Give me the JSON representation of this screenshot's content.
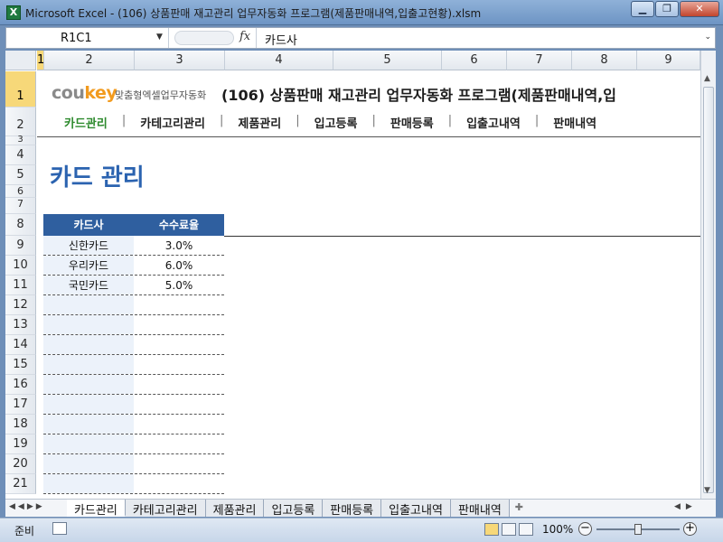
{
  "window": {
    "title": "Microsoft Excel - (106) 상품판매 재고관리 업무자동화 프로그램(제품판매내역,입출고현황).xlsm",
    "icon": "excel-icon",
    "minimize": "▁",
    "restore": "❐",
    "close": "✕"
  },
  "formula_bar": {
    "name_box": "R1C1",
    "fx": "fx",
    "content": "카드사"
  },
  "grid": {
    "columns": [
      "1",
      "2",
      "3",
      "4",
      "5",
      "6",
      "7",
      "8",
      "9"
    ],
    "rows": [
      "1",
      "2",
      "3",
      "4",
      "5",
      "6",
      "7",
      "8",
      "9",
      "10",
      "11",
      "12",
      "13",
      "14",
      "15",
      "16",
      "17",
      "18",
      "19",
      "20",
      "21"
    ]
  },
  "sheet": {
    "logo_text": "cou",
    "logo_accent": "key",
    "logo_sub": "맞춤형엑셀업무자동화",
    "app_title": "(106) 상품판매 재고관리 업무자동화 프로그램(제품판매내역,입",
    "menu": [
      "카드관리",
      "카테고리관리",
      "제품관리",
      "입고등록",
      "판매등록",
      "입출고내역",
      "판매내역"
    ],
    "page_title": "카드 관리",
    "table": {
      "headers": [
        "카드사",
        "수수료율"
      ],
      "rows": [
        [
          "신한카드",
          "3.0%"
        ],
        [
          "우리카드",
          "6.0%"
        ],
        [
          "국민카드",
          "5.0%"
        ]
      ]
    }
  },
  "tabs": [
    "카드관리",
    "카테고리관리",
    "제품관리",
    "입고등록",
    "판매등록",
    "입출고내역",
    "판매내역"
  ],
  "status": {
    "ready": "준비",
    "zoom": "100%"
  },
  "colors": {
    "title_blue": "#2b63b0",
    "header_fill": "#2f5f9f",
    "menu_active": "#2d8a2d",
    "logo_orange": "#f29b1f"
  }
}
